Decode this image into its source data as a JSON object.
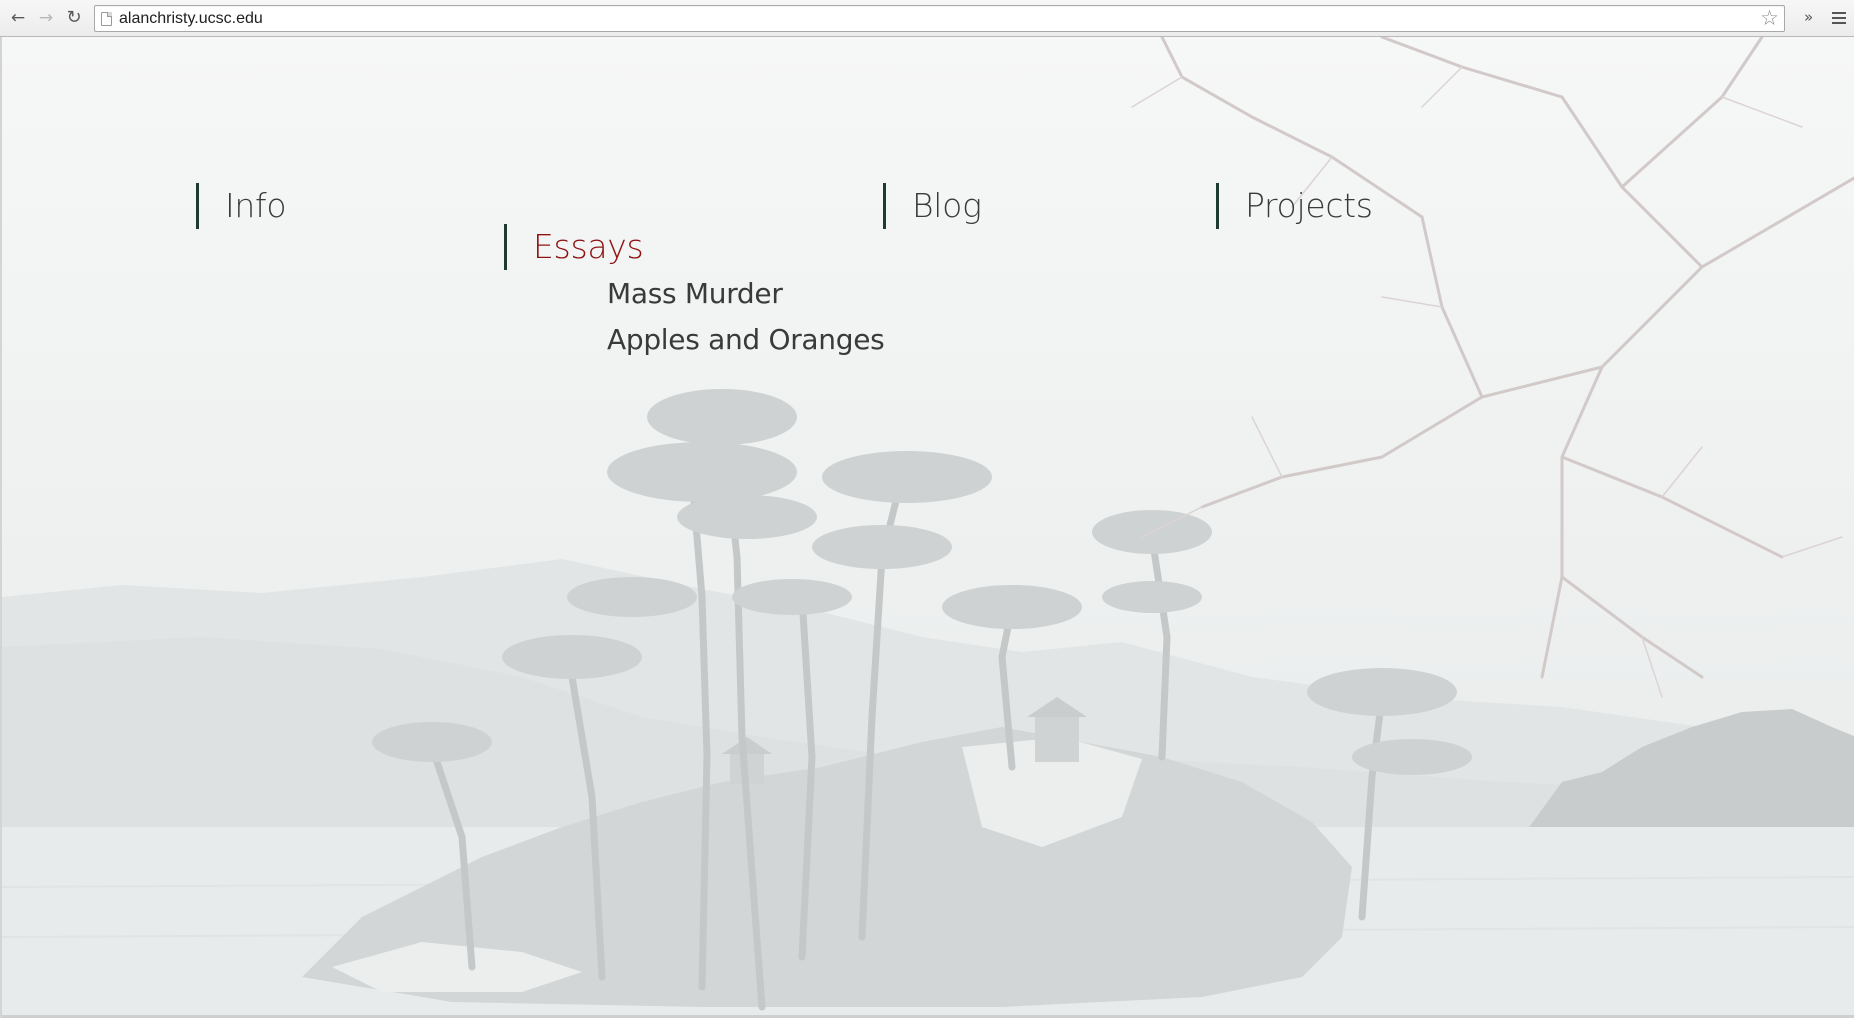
{
  "browser": {
    "url": "alanchristy.ucsc.edu",
    "back_icon": "arrow-left-icon",
    "forward_icon": "arrow-right-icon",
    "reload_icon": "reload-icon",
    "bookmark_icon": "star-icon",
    "extensions_icon": "chevron-double-right-icon",
    "menu_icon": "hamburger-menu-icon"
  },
  "nav": {
    "items": [
      {
        "label": "Info",
        "active": false
      },
      {
        "label": "Essays",
        "active": true
      },
      {
        "label": "Blog",
        "active": false
      },
      {
        "label": "Projects",
        "active": false
      }
    ],
    "essays_submenu": [
      {
        "label": "Mass Murder"
      },
      {
        "label": "Apples and Oranges"
      }
    ]
  },
  "colors": {
    "active_link": "#8e1414",
    "link": "#3a3a3a",
    "nav_rule": "#1e3a33",
    "background": "#f4f5f5"
  }
}
